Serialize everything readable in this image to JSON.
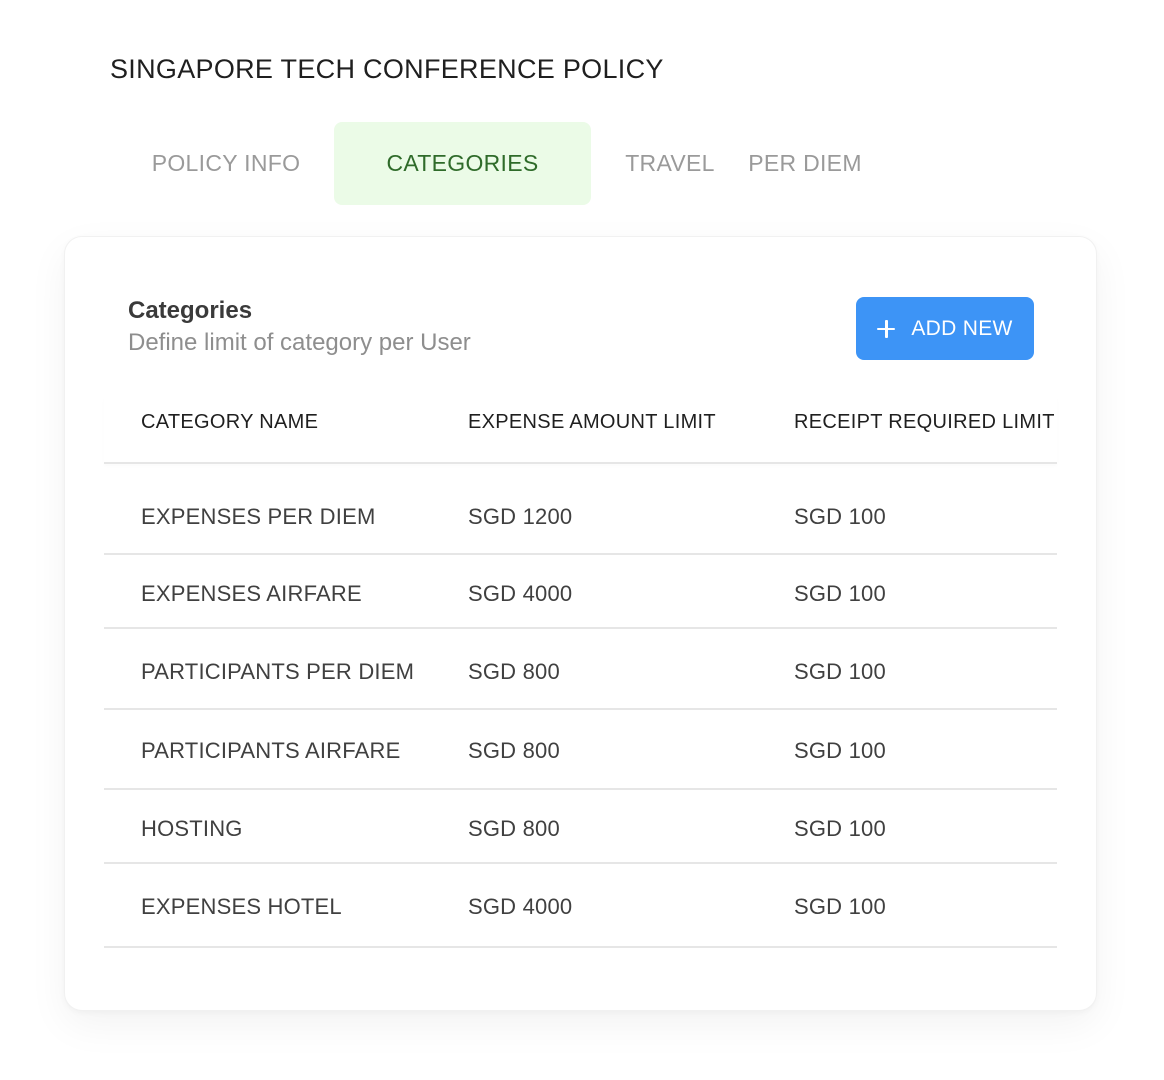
{
  "page": {
    "title": "SINGAPORE TECH CONFERENCE POLICY"
  },
  "tabs": [
    {
      "label": "POLICY INFO",
      "active": false
    },
    {
      "label": "CATEGORIES",
      "active": true
    },
    {
      "label": "TRAVEL",
      "active": false
    },
    {
      "label": "PER DIEM",
      "active": false
    }
  ],
  "card": {
    "heading": "Categories",
    "subheading": "Define limit of category per User",
    "add_button": {
      "icon": "plus-icon",
      "label": "ADD NEW"
    }
  },
  "table": {
    "columns": [
      "CATEGORY NAME",
      "EXPENSE AMOUNT LIMIT",
      "RECEIPT REQUIRED LIMIT"
    ],
    "rows": [
      {
        "category": "EXPENSES PER DIEM",
        "expense_limit": "SGD 1200",
        "receipt_limit": "SGD 100"
      },
      {
        "category": "EXPENSES AIRFARE",
        "expense_limit": "SGD 4000",
        "receipt_limit": "SGD 100"
      },
      {
        "category": "PARTICIPANTS PER DIEM",
        "expense_limit": "SGD 800",
        "receipt_limit": "SGD 100"
      },
      {
        "category": "PARTICIPANTS AIRFARE",
        "expense_limit": "SGD 800",
        "receipt_limit": "SGD 100"
      },
      {
        "category": "HOSTING",
        "expense_limit": "SGD 800",
        "receipt_limit": "SGD 100"
      },
      {
        "category": "EXPENSES HOTEL",
        "expense_limit": "SGD 4000",
        "receipt_limit": "SGD 100"
      }
    ]
  },
  "colors": {
    "active_tab_bg": "#ebfbe7",
    "active_tab_text": "#2f6b2a",
    "inactive_tab_text": "#9a9a9a",
    "primary_button": "#3d94f6"
  }
}
